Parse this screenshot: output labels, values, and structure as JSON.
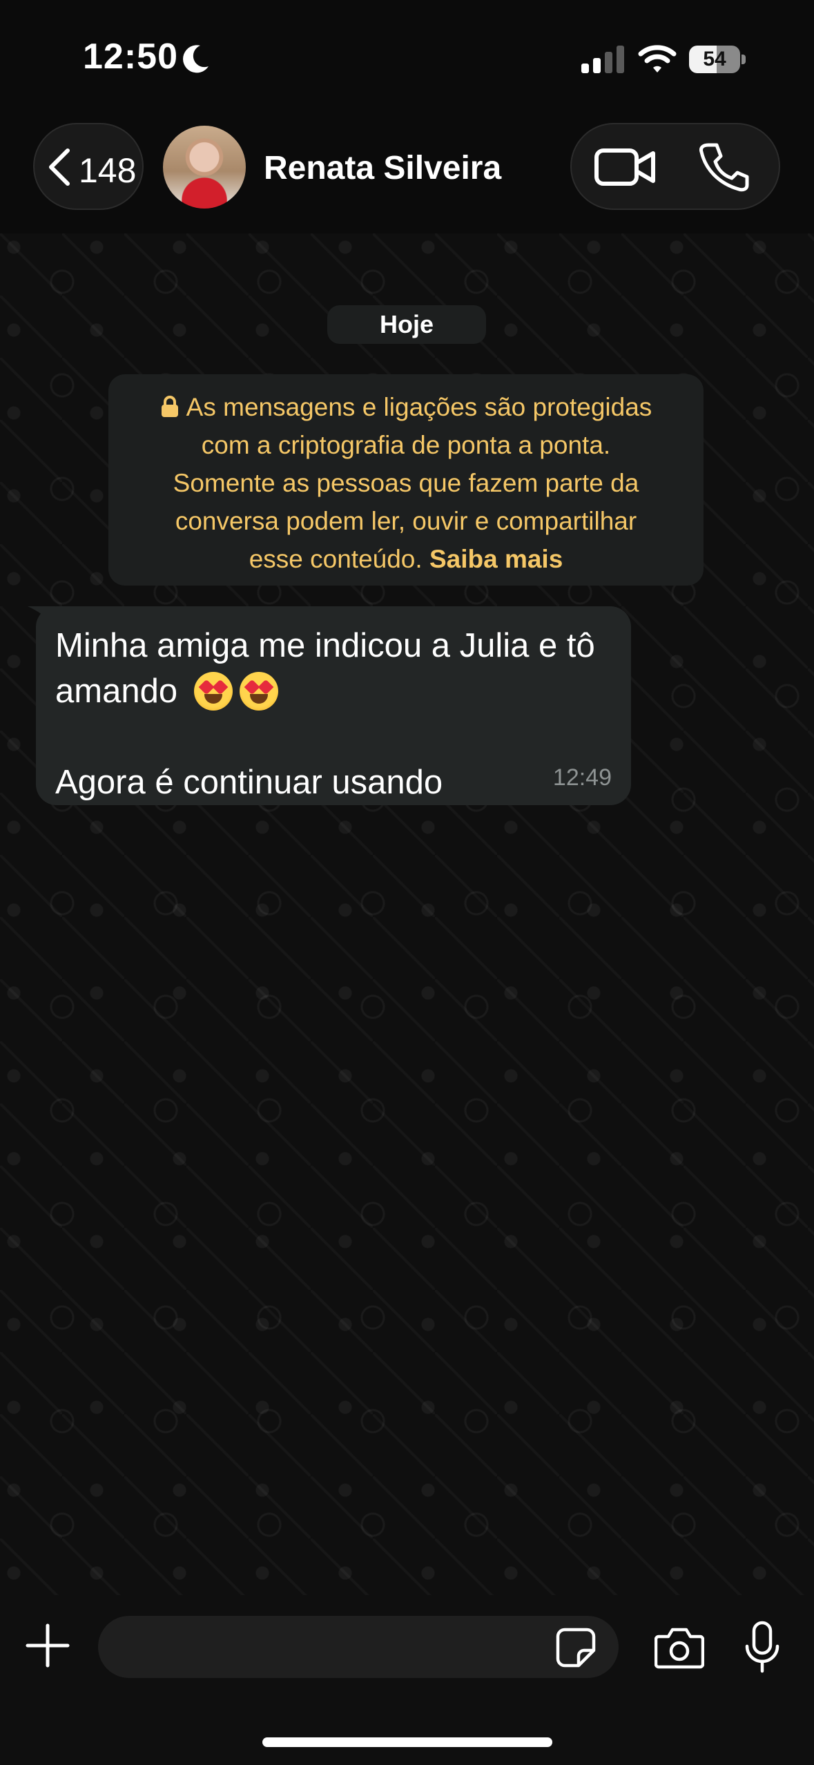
{
  "status_bar": {
    "time": "12:50",
    "battery_level": "54",
    "battery_fraction": 0.54,
    "moon_icon": "moon-icon",
    "signal_icon": "signal-icon",
    "wifi_icon": "wifi-icon"
  },
  "header": {
    "back_count": "148",
    "contact_name": "Renata Silveira",
    "video_icon": "video-camera-icon",
    "call_icon": "phone-icon"
  },
  "chat": {
    "date_label": "Hoje",
    "encryption_notice": {
      "line1": "As mensagens e ligações são protegidas",
      "line2": "com a criptografia de ponta a ponta.",
      "line3": "Somente as pessoas que fazem parte da",
      "line4": "conversa podem ler, ouvir e compartilhar",
      "line5_text": "esse conteúdo. ",
      "link": "Saiba mais"
    },
    "message": {
      "line1": "Minha amiga me indicou a Julia e tô",
      "line2": "amando",
      "emojis": "😍😍",
      "line3": "Agora é continuar usando",
      "time": "12:49"
    }
  },
  "composer": {
    "input_value": "",
    "attach_icon": "plus-icon",
    "sticker_icon": "sticker-icon",
    "camera_icon": "camera-icon",
    "mic_icon": "microphone-icon"
  },
  "colors": {
    "accent_notice": "#f5c767",
    "bubble": "#232626",
    "background": "#0b0b0b"
  }
}
